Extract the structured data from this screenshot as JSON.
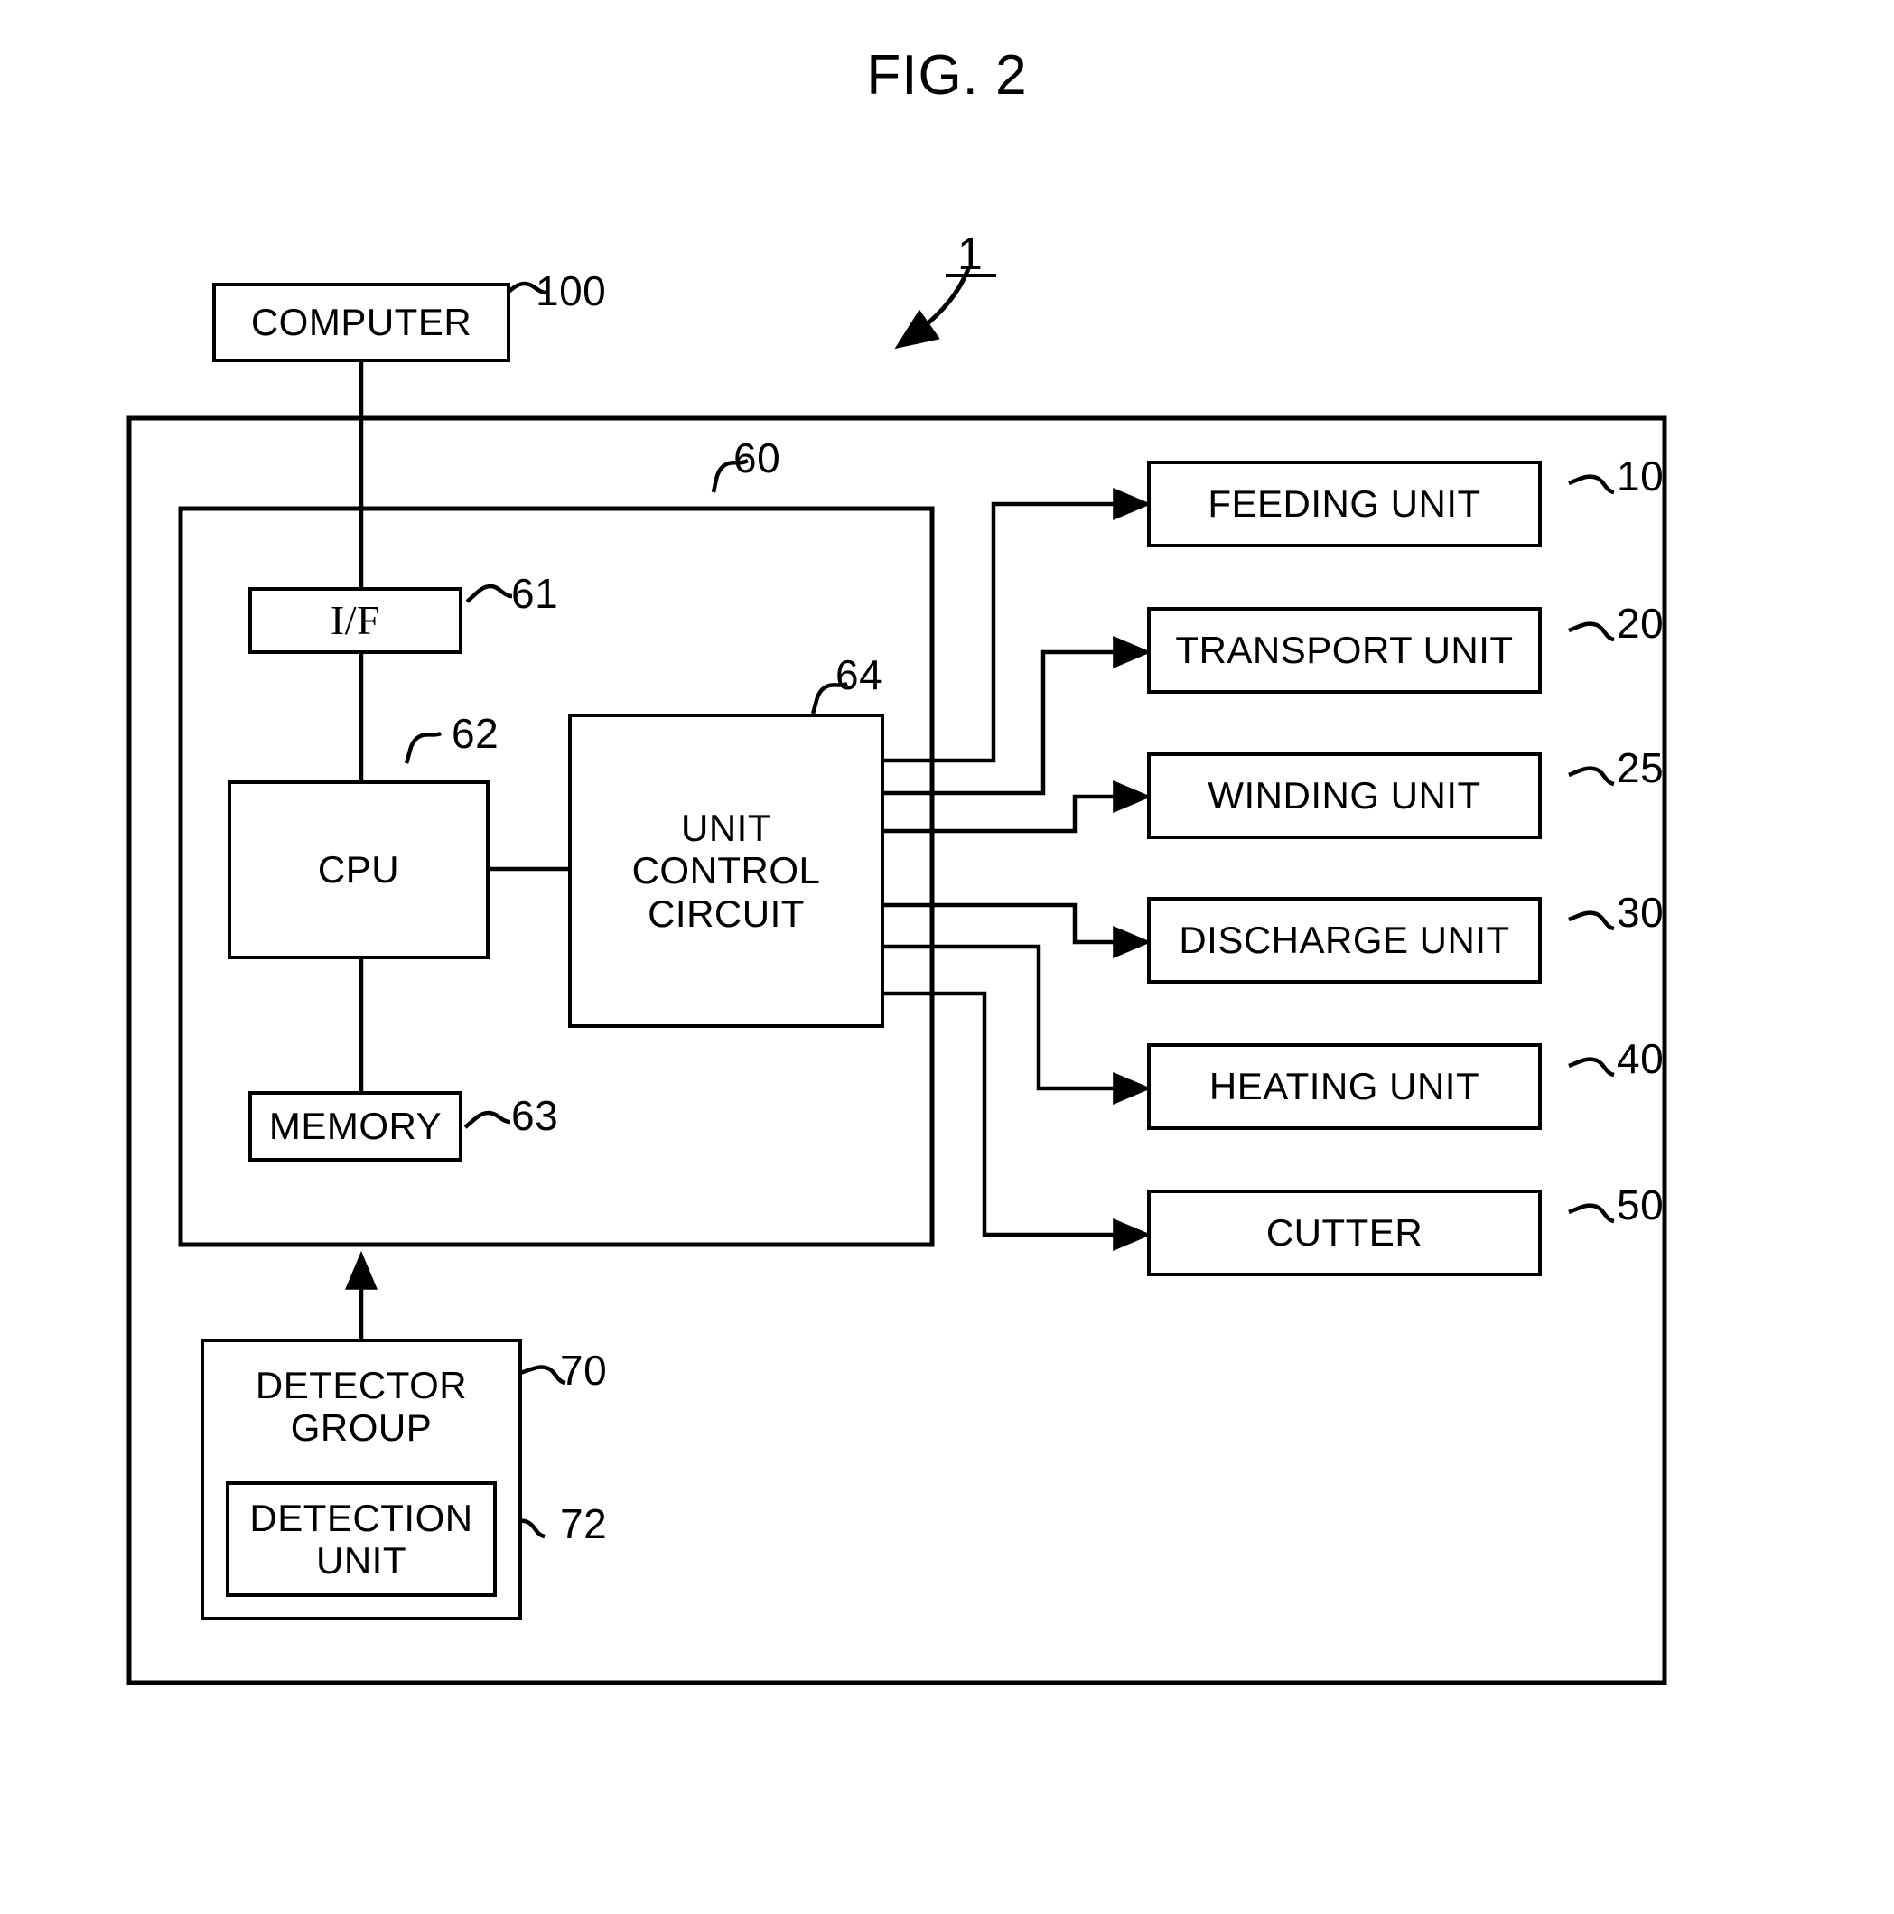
{
  "figure": {
    "title": "FIG. 2",
    "system_reference": "1"
  },
  "blocks": {
    "computer": {
      "label": "COMPUTER",
      "ref": "100"
    },
    "interface": {
      "label": "I/F",
      "ref": "61"
    },
    "cpu": {
      "label": "CPU",
      "ref": "62"
    },
    "memory": {
      "label": "MEMORY",
      "ref": "63"
    },
    "unit_control_circuit": {
      "label": "UNIT\nCONTROL\nCIRCUIT",
      "ref": "64"
    },
    "controller": {
      "ref": "60"
    },
    "detector_group": {
      "label": "DETECTOR\nGROUP",
      "ref": "70"
    },
    "detection_unit": {
      "label": "DETECTION\nUNIT",
      "ref": "72"
    }
  },
  "units": [
    {
      "label": "FEEDING UNIT",
      "ref": "10"
    },
    {
      "label": "TRANSPORT UNIT",
      "ref": "20"
    },
    {
      "label": "WINDING UNIT",
      "ref": "25"
    },
    {
      "label": "DISCHARGE UNIT",
      "ref": "30"
    },
    {
      "label": "HEATING UNIT",
      "ref": "40"
    },
    {
      "label": "CUTTER",
      "ref": "50"
    }
  ]
}
